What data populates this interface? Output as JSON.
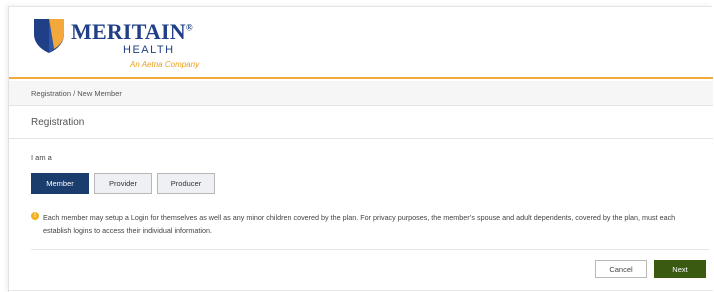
{
  "brand": {
    "name": "MERITAIN",
    "registered": "®",
    "sub": "HEALTH",
    "tagline": "An Aetna Company",
    "colors": {
      "navy": "#1f3f86",
      "gold": "#f2a83a"
    }
  },
  "breadcrumb": "Registration / New Member",
  "page_title": "Registration",
  "form": {
    "role_label": "I am a",
    "roles": [
      {
        "label": "Member",
        "selected": true
      },
      {
        "label": "Provider",
        "selected": false
      },
      {
        "label": "Producer",
        "selected": false
      }
    ]
  },
  "notice": {
    "icon": "info-icon",
    "text": "Each member may setup a Login for themselves as well as any minor children covered by the plan. For privacy purposes, the member’s spouse and adult dependents, covered by the plan, must each establish logins to access their individual information."
  },
  "actions": {
    "cancel_label": "Cancel",
    "next_label": "Next",
    "next_color": "#3a5a12"
  }
}
